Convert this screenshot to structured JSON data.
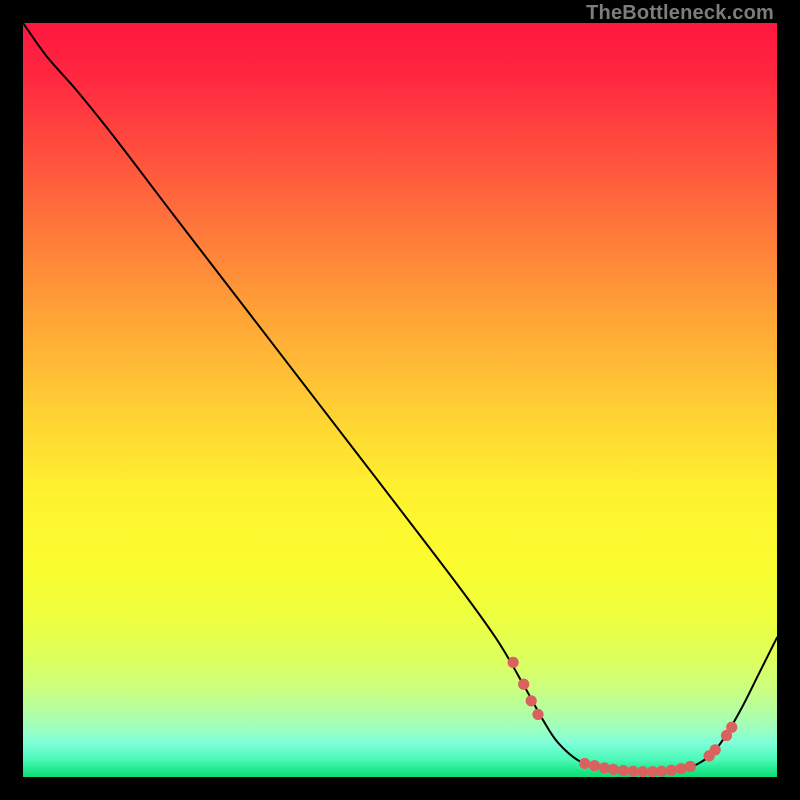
{
  "attribution": "TheBottleneck.com",
  "chart_data": {
    "type": "line",
    "title": "",
    "xlabel": "",
    "ylabel": "",
    "xlim": [
      0,
      100
    ],
    "ylim": [
      0,
      100
    ],
    "grid": false,
    "legend": false,
    "background_gradient_stops": [
      {
        "pos": 0.0,
        "color": "#ff173f"
      },
      {
        "pos": 0.07,
        "color": "#ff2740"
      },
      {
        "pos": 0.16,
        "color": "#ff4a3e"
      },
      {
        "pos": 0.27,
        "color": "#ff763b"
      },
      {
        "pos": 0.39,
        "color": "#ffa437"
      },
      {
        "pos": 0.52,
        "color": "#ffd233"
      },
      {
        "pos": 0.62,
        "color": "#fff12f"
      },
      {
        "pos": 0.72,
        "color": "#fbfd2f"
      },
      {
        "pos": 0.79,
        "color": "#edff40"
      },
      {
        "pos": 0.84,
        "color": "#deff5c"
      },
      {
        "pos": 0.877,
        "color": "#cfff79"
      },
      {
        "pos": 0.91,
        "color": "#b6ff9d"
      },
      {
        "pos": 0.935,
        "color": "#9effbe"
      },
      {
        "pos": 0.955,
        "color": "#7effd9"
      },
      {
        "pos": 0.978,
        "color": "#48f8b5"
      },
      {
        "pos": 0.992,
        "color": "#1de688"
      },
      {
        "pos": 1.0,
        "color": "#0fde77"
      }
    ],
    "series": [
      {
        "name": "curve",
        "x": [
          0.0,
          3.2,
          7.0,
          12.0,
          20.0,
          30.0,
          40.0,
          50.0,
          58.0,
          63.0,
          66.5,
          69.0,
          71.0,
          74.0,
          78.0,
          82.0,
          86.0,
          89.0,
          91.5,
          93.5,
          95.5,
          97.5,
          100.0
        ],
        "y": [
          100.0,
          95.5,
          91.2,
          85.0,
          74.5,
          61.5,
          48.5,
          35.5,
          25.0,
          18.0,
          12.0,
          7.5,
          4.5,
          2.0,
          0.9,
          0.6,
          0.7,
          1.5,
          3.2,
          6.0,
          9.5,
          13.5,
          18.5
        ],
        "stroke": "#000000",
        "stroke_width": 2.0
      }
    ],
    "markers": [
      {
        "x": 65.0,
        "y": 15.2
      },
      {
        "x": 66.4,
        "y": 12.3
      },
      {
        "x": 67.4,
        "y": 10.1
      },
      {
        "x": 68.3,
        "y": 8.3
      },
      {
        "x": 74.5,
        "y": 1.8
      },
      {
        "x": 75.8,
        "y": 1.5
      },
      {
        "x": 77.1,
        "y": 1.2
      },
      {
        "x": 78.3,
        "y": 1.0
      },
      {
        "x": 79.6,
        "y": 0.85
      },
      {
        "x": 80.9,
        "y": 0.75
      },
      {
        "x": 82.2,
        "y": 0.7
      },
      {
        "x": 83.5,
        "y": 0.7
      },
      {
        "x": 84.7,
        "y": 0.75
      },
      {
        "x": 86.0,
        "y": 0.9
      },
      {
        "x": 87.3,
        "y": 1.1
      },
      {
        "x": 88.5,
        "y": 1.4
      },
      {
        "x": 91.0,
        "y": 2.8
      },
      {
        "x": 91.8,
        "y": 3.6
      },
      {
        "x": 93.3,
        "y": 5.5
      },
      {
        "x": 94.0,
        "y": 6.6
      }
    ],
    "marker_style": {
      "fill": "#d9625e",
      "radius": 5.6
    }
  }
}
